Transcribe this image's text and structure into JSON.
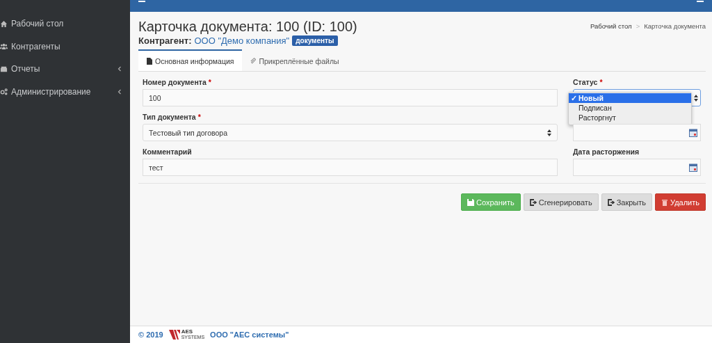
{
  "sidebar": {
    "items": [
      {
        "label": "Рабочий стол",
        "submenu": false
      },
      {
        "label": "Контрагенты",
        "submenu": false
      },
      {
        "label": "Отчеты",
        "submenu": true
      },
      {
        "label": "Администрирование",
        "submenu": true
      }
    ]
  },
  "breadcrumb": [
    "Рабочий стол",
    "Карточка документа"
  ],
  "breadcrumb_separator": ">",
  "title": "Карточка документа: 100 (ID: 100)",
  "counterparty": {
    "label": "Контрагент:",
    "link": "ООО \"Демо компания\"",
    "badge": "документы"
  },
  "tabs": [
    {
      "label": "Основная информация",
      "selected": true
    },
    {
      "label": "Прикреплённые файлы",
      "selected": false
    }
  ],
  "form": {
    "left": [
      {
        "kind": "input",
        "label": "Номер документа",
        "marker": "*",
        "value": "100"
      },
      {
        "kind": "select",
        "label": "Тип документа",
        "marker": "*",
        "value": "Тестовый тип договора"
      },
      {
        "kind": "input",
        "label": "Комментарий",
        "value": "тест"
      }
    ],
    "status": {
      "label": "Статус",
      "marker": "*",
      "tick": "✓",
      "options": [
        {
          "label": "Новый",
          "selected": true
        },
        {
          "label": "Подписан",
          "selected": false
        },
        {
          "label": "Расторгнут",
          "selected": false
        }
      ]
    },
    "dates": [
      {
        "kind": "date"
      },
      {
        "kind": "date",
        "label": "Дата расторжения"
      }
    ]
  },
  "buttons": [
    {
      "kind": "save",
      "label": "Сохранить"
    },
    {
      "kind": "default",
      "label": "Сгенерировать"
    },
    {
      "kind": "default",
      "label": "Закрыть"
    },
    {
      "kind": "danger",
      "label": "Удалить"
    }
  ],
  "footer": {
    "copyright": "© 2019",
    "logo": [
      "AES",
      "SYSTEMS"
    ],
    "company": "ООО \"АЕС системы\""
  }
}
